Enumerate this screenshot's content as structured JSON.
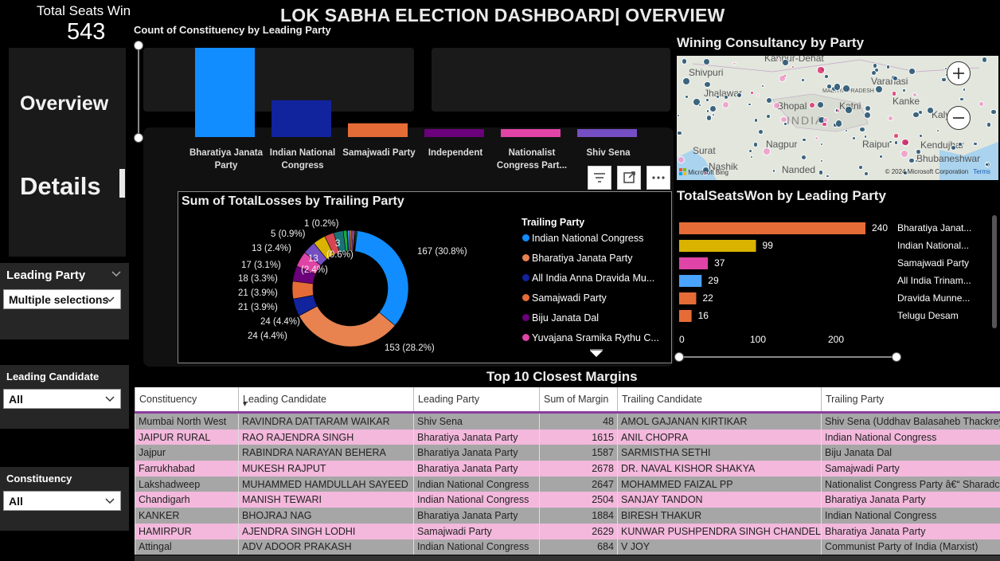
{
  "header": {
    "title": "LOK SABHA ELECTION DASHBOARD| OVERVIEW",
    "kpi_label": "Total Seats Win",
    "kpi_value": "543"
  },
  "nav": {
    "overview": "Overview",
    "details": "Details"
  },
  "slicers": [
    {
      "title": "Leading Party",
      "value": "Multiple selections"
    },
    {
      "title": "Leading Candidate",
      "value": "All"
    },
    {
      "title": "Constituency",
      "value": "All"
    }
  ],
  "colors": {
    "bjp": "#118dff",
    "inc": "#12239e",
    "sp": "#e66c37",
    "ind": "#6b007b",
    "ncp": "#e044a7",
    "ss": "#744ec2",
    "hbar_orange": "#e66c37",
    "hbar_yellow": "#d9b300",
    "table_odd": "#a6a6a6",
    "table_even": "#f3b8dc",
    "accent_purple": "#8a3d9e"
  },
  "chart_data": [
    {
      "type": "bar",
      "title": "Count of Constituency by Leading Party",
      "categories": [
        "Bharatiya Janata Party",
        "Indian National Congress",
        "Samajwadi Party",
        "Independent",
        "Nationalist Congress Part...",
        "Shiv Sena"
      ],
      "values": [
        240,
        99,
        37,
        7,
        8,
        7
      ]
    },
    {
      "type": "pie",
      "title": "Sum of TotalLosses by Trailing Party",
      "legend_title": "Trailing Party",
      "legend": [
        "Indian National Congress",
        "Bharatiya Janata Party",
        "All India Anna Dravida Mu...",
        "Samajwadi Party",
        "Biju Janata Dal",
        "Yuvajana Sramika Rythu C..."
      ],
      "labels": [
        "167 (30.8%)",
        "153 (28.2%)",
        "24 (4.4%)",
        "24 (4.4%)",
        "21 (3.9%)",
        "21 (3.9%)",
        "18 (3.3%)",
        "17 (3.1%)",
        "13 (2.4%)",
        "13 (2.4%)",
        "5 (0.9%)",
        "1 (0.2%)",
        "3 (0.6%)"
      ],
      "values": [
        167,
        153,
        24,
        24,
        21,
        21,
        18,
        17,
        13,
        13,
        5,
        1,
        3,
        2,
        2,
        2,
        1,
        1,
        1,
        1
      ],
      "colors": [
        "#118dff",
        "#e8834f",
        "#12239e",
        "#e66c37",
        "#6b007b",
        "#e044a7",
        "#744ec2",
        "#d9b300",
        "#d64550",
        "#197278",
        "#1aab40",
        "#15c6f4",
        "#4092ff",
        "#ffa058",
        "#be5dc9",
        "#f472d0",
        "#b5a1ff",
        "#c4a200",
        "#ff8080",
        "#00dbbc"
      ]
    },
    {
      "type": "bar",
      "orientation": "horizontal",
      "title": "TotalSeatsWon by Leading Party",
      "categories": [
        "Bharatiya Janat...",
        "Indian National...",
        "Samajwadi Party",
        "All India Trinam...",
        "Dravida Munne...",
        "Telugu Desam"
      ],
      "values": [
        240,
        99,
        37,
        29,
        22,
        16
      ],
      "colors": [
        "#e66c37",
        "#d9b300",
        "#e044a7",
        "#4aa3ff",
        "#e66c37",
        "#e66c37"
      ],
      "xticks": [
        "0",
        "100",
        "200"
      ],
      "xlim": [
        0,
        240
      ]
    }
  ],
  "map": {
    "title": "Wining Consultancy by Party",
    "labels": [
      "Kanpur-Dehat",
      "Shivpuri",
      "Varanasi",
      "Jhalawar",
      "MADHYA PRADESH",
      "Bhopal",
      "Katni",
      "INDIA",
      "Kanke",
      "Surat",
      "Nagpur",
      "Raipur",
      "Nashik",
      "Nanded",
      "Kendujhar",
      "Bhubaneshwar",
      "Kalyani"
    ],
    "credit": "© 2024 Microsoft Corporation",
    "terms": "Terms",
    "logo_text": "Microsoft Bing"
  },
  "table": {
    "title": "Top 10 Closest Margins",
    "columns": [
      "Constituency",
      "Leading Candidate",
      "Leading Party",
      "Sum of Margin",
      "Trailing Candidate",
      "Trailing Party"
    ],
    "rows": [
      [
        "Mumbai North West",
        "RAVINDRA DATTARAM WAIKAR",
        "Shiv Sena",
        "48",
        "AMOL GAJANAN KIRTIKAR",
        "Shiv Sena (Uddhav Balasaheb Thackrey)"
      ],
      [
        "JAIPUR RURAL",
        "RAO RAJENDRA SINGH",
        "Bharatiya Janata Party",
        "1615",
        "ANIL CHOPRA",
        "Indian National Congress"
      ],
      [
        "Jajpur",
        "RABINDRA NARAYAN BEHERA",
        "Bharatiya Janata Party",
        "1587",
        "SARMISTHA SETHI",
        "Biju Janata Dal"
      ],
      [
        "Farrukhabad",
        "MUKESH RAJPUT",
        "Bharatiya Janata Party",
        "2678",
        "DR. NAVAL KISHOR SHAKYA",
        "Samajwadi Party"
      ],
      [
        "Lakshadweep",
        "MUHAMMED HAMDULLAH SAYEED",
        "Indian National Congress",
        "2647",
        "MOHAMMED FAIZAL PP",
        "Nationalist Congress Party â€“ Sharadchandra Pawar"
      ],
      [
        "Chandigarh",
        "MANISH TEWARI",
        "Indian National Congress",
        "2504",
        "SANJAY TANDON",
        "Bharatiya Janata Party"
      ],
      [
        "KANKER",
        "BHOJRAJ NAG",
        "Bharatiya Janata Party",
        "1884",
        "BIRESH THAKUR",
        "Indian National Congress"
      ],
      [
        "HAMIRPUR",
        "AJENDRA SINGH LODHI",
        "Samajwadi Party",
        "2629",
        "KUNWAR PUSHPENDRA SINGH CHANDEL",
        "Bharatiya Janata Party"
      ],
      [
        "Attingal",
        "ADV ADOOR PRAKASH",
        "Indian National Congress",
        "684",
        "V JOY",
        "Communist Party of India (Marxist)"
      ]
    ]
  }
}
